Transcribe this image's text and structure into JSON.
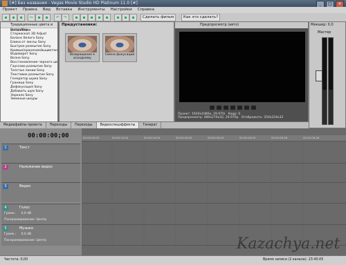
{
  "window": {
    "title": "[#] Без названия - Vegas Movie Studio HD Platinum 11.0 [#]"
  },
  "menu": [
    "Проект",
    "Правка",
    "Вид",
    "Вставка",
    "Инструменты",
    "Настройки",
    "Справка"
  ],
  "toolbar": {
    "make_movie": "Сделать фильм",
    "how_to": "Как это сделать?"
  },
  "left_panel": {
    "header": "Традиционные цвета и искажения",
    "items": [
      "Bump Map",
      "Стереоскоп 3D Adjust",
      "Баланс белого Sony",
      "Блики от линзы Sony",
      "Быстрое размытие Sony",
      "Кривые/хранение/выцветание",
      "Водоворот Sony",
      "Волна Sony",
      "Восстановление черного цвета",
      "Гауссово размытие Sony",
      "Толстые линии Sony",
      "Текстовое размытие Sony",
      "Генератор шума Sony",
      "Граница Sony",
      "Дефокусация Sony",
      "Добавить шум Sony",
      "Зеркало Sony",
      "Змеиные шкуры"
    ]
  },
  "presets": {
    "label": "Предустановки:",
    "items": [
      "Возвращение к исходному",
      "Смена фокусации"
    ]
  },
  "preview": {
    "mode": "Предпросмотр (авто)",
    "info": [
      [
        "Проект:",
        "1920x1080x, 29.970i",
        "Кадр:",
        "0"
      ],
      [
        "Предпросмотр:",
        "480x270x32, 29.970p",
        "Отображать:",
        "350x224x32"
      ]
    ]
  },
  "mixer": {
    "title": "Мастер",
    "label": "Микшер: 0,0"
  },
  "tabs": [
    "Медиафайлы проекта",
    "Переходы",
    "Переходы",
    "Видеоспецэффекты",
    "Генерат"
  ],
  "timeline": {
    "timecode": "00:00:00;00",
    "ruler": [
      "00:00:00;00",
      "00:00:10;00",
      "00:00:19;29",
      "00:00:29;29",
      "00:00:39;29",
      "00:00:49;29",
      "00:00:59;28",
      "00:01:09;28"
    ],
    "tracks": [
      {
        "num": "1",
        "name": "Текст",
        "color": "#3b6ea8"
      },
      {
        "num": "2",
        "name": "Наложение видео",
        "color": "#b0458a"
      },
      {
        "num": "3",
        "name": "Видео",
        "color": "#3b6ea8"
      },
      {
        "num": "4",
        "name": "Голос",
        "color": "#3b8f8a",
        "vol": "Громк.:",
        "vol_val": "0,0 dB",
        "pan": "Панорамирование:",
        "pan_val": "Центр"
      },
      {
        "num": "5",
        "name": "Музыка",
        "color": "#3b8f8a",
        "vol": "Громк.:",
        "vol_val": "0,0 dB",
        "pan": "Панорамирование:",
        "pan_val": "Центр"
      }
    ],
    "rate": "Частота: 0,00"
  },
  "status": {
    "record_time": "Время записи (2 канала): 23:40:05"
  },
  "watermark": "Kazachya.net"
}
